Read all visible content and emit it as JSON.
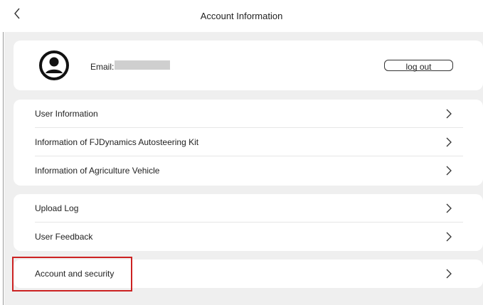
{
  "header": {
    "title": "Account Information",
    "back_icon": "chevron-left-icon"
  },
  "profile": {
    "avatar_icon": "user-avatar-icon",
    "email_label": "Email:",
    "email_value_masked": true,
    "logout_label": "log out"
  },
  "info_menu": {
    "items": [
      {
        "label": "User Information"
      },
      {
        "label": "Information of FJDynamics Autosteering Kit"
      },
      {
        "label": "Information of Agriculture Vehicle"
      }
    ]
  },
  "tools_menu": {
    "items": [
      {
        "label": "Upload Log"
      },
      {
        "label": "User Feedback"
      }
    ]
  },
  "security_menu": {
    "items": [
      {
        "label": "Account and security"
      }
    ]
  },
  "colors": {
    "background": "#efefef",
    "card": "#ffffff",
    "highlight": "#cc2222",
    "text": "#222222"
  }
}
